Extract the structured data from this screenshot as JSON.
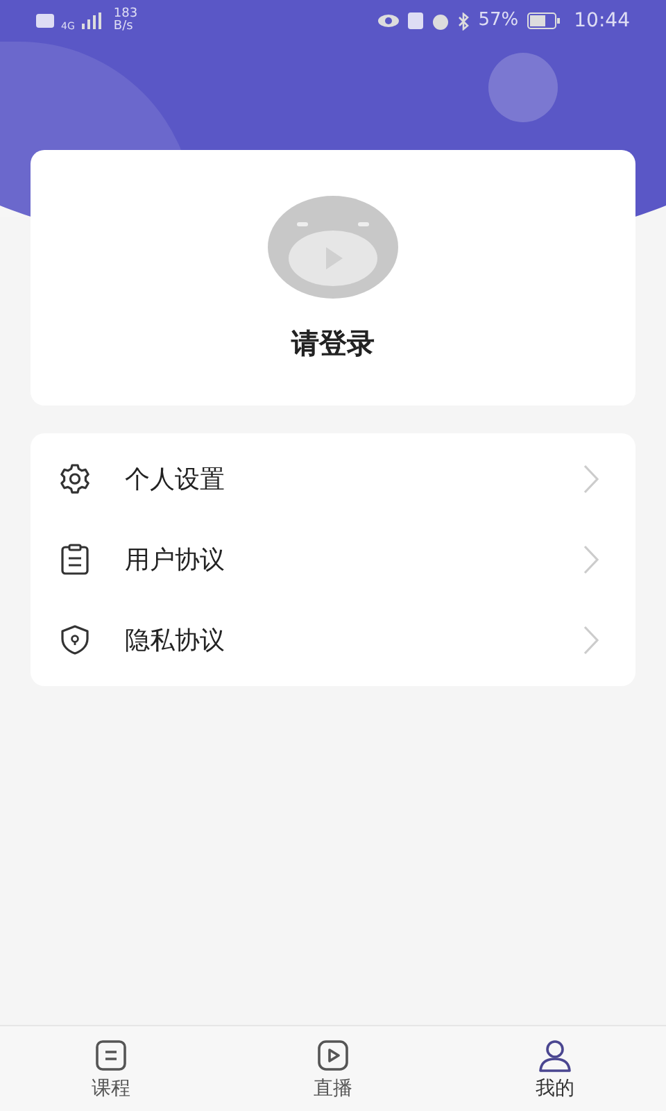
{
  "status_bar": {
    "network": "4G",
    "speed": "183",
    "speed_unit": "B/s",
    "battery": "57%",
    "time": "10:44"
  },
  "profile": {
    "login_prompt": "请登录"
  },
  "menu": [
    {
      "kind": "settings",
      "label": "个人设置"
    },
    {
      "kind": "agreement",
      "label": "用户协议"
    },
    {
      "kind": "privacy",
      "label": "隐私协议"
    }
  ],
  "tab_bar": [
    {
      "kind": "courses",
      "label": "课程",
      "selected": false
    },
    {
      "kind": "live",
      "label": "直播",
      "selected": false
    },
    {
      "kind": "me",
      "label": "我的",
      "selected": true
    }
  ]
}
